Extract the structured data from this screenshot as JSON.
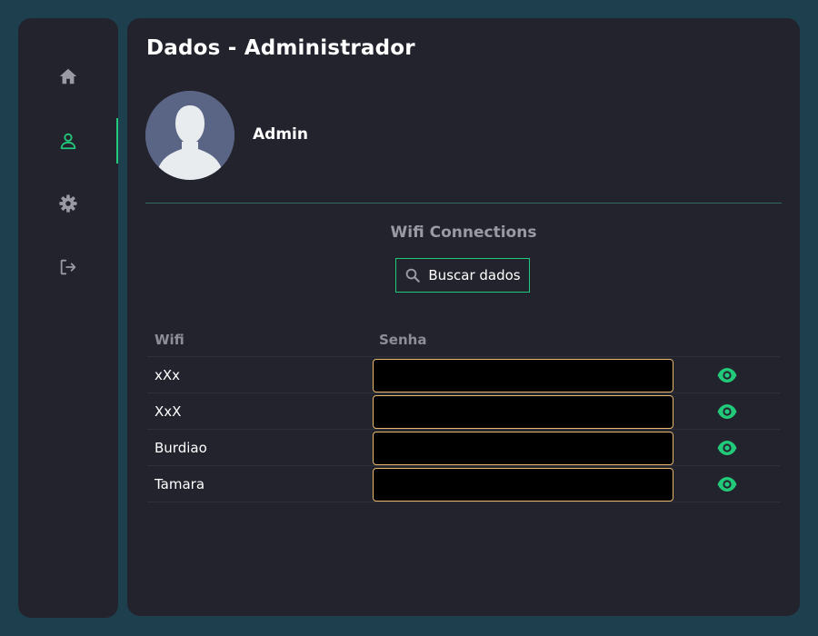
{
  "sidebar": {
    "items": [
      {
        "name": "home",
        "icon": "home-icon",
        "active": false
      },
      {
        "name": "profile",
        "icon": "user-icon",
        "active": true
      },
      {
        "name": "settings",
        "icon": "gear-icon",
        "active": false
      },
      {
        "name": "logout",
        "icon": "logout-icon",
        "active": false
      }
    ],
    "active_color": "#22c97a",
    "icon_color": "#9a9aa5"
  },
  "header": {
    "title": "Dados - Administrador"
  },
  "profile": {
    "name": "Admin",
    "avatar_icon": "user-avatar-icon"
  },
  "wifi": {
    "section_title": "Wifi Connections",
    "search_label": "Buscar dados",
    "columns": [
      "Wifi",
      "Senha"
    ],
    "rows": [
      {
        "wifi": "xXx",
        "senha": "••••••••"
      },
      {
        "wifi": "XxX",
        "senha": "••••••••"
      },
      {
        "wifi": "Burdiao",
        "senha": "••••••••"
      },
      {
        "wifi": "Tamara",
        "senha": "••••••••"
      }
    ]
  },
  "colors": {
    "background": "#1e3f4d",
    "panel": "#23232e",
    "accent": "#22c97a",
    "password_border": "#e9b96b"
  }
}
